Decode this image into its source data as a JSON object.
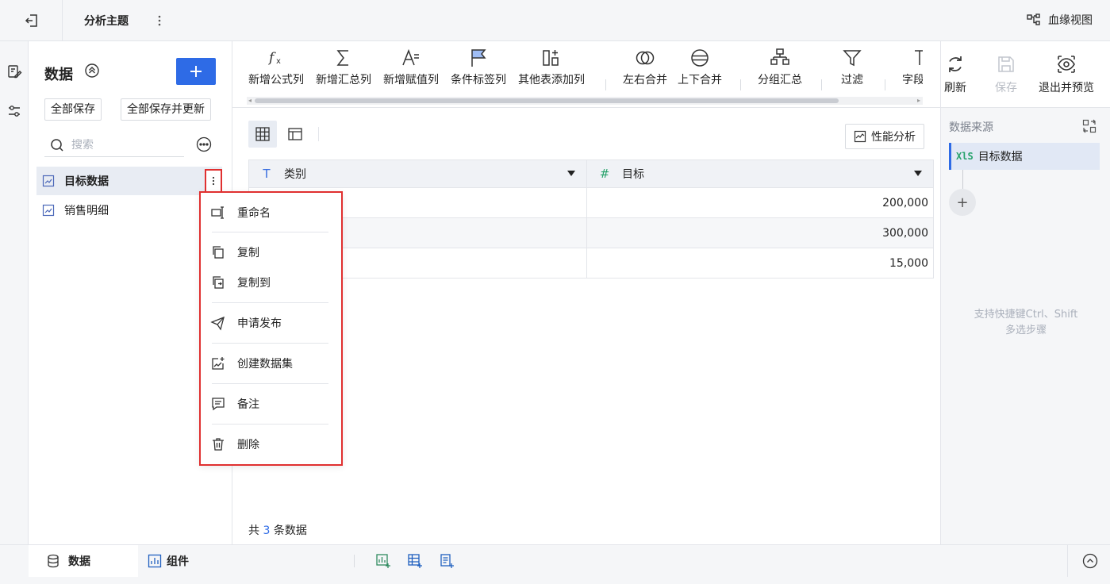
{
  "header": {
    "title": "分析主题",
    "lineage_label": "血缘视图"
  },
  "left_panel": {
    "title": "数据",
    "save_all": "全部保存",
    "save_all_update": "全部保存并更新",
    "search_placeholder": "搜索",
    "datasets": [
      {
        "name": "目标数据",
        "active": true
      },
      {
        "name": "销售明细",
        "active": false
      }
    ]
  },
  "context_menu": {
    "items": [
      {
        "label": "重命名",
        "icon": "rename-icon"
      },
      {
        "label": "复制",
        "icon": "copy-icon"
      },
      {
        "label": "复制到",
        "icon": "copy-to-icon"
      },
      {
        "label": "申请发布",
        "icon": "publish-icon"
      },
      {
        "label": "创建数据集",
        "icon": "create-dataset-icon"
      },
      {
        "label": "备注",
        "icon": "note-icon"
      },
      {
        "label": "删除",
        "icon": "trash-icon"
      }
    ]
  },
  "toolbar": {
    "items": [
      {
        "label": "新增公式列",
        "icon": "formula-icon"
      },
      {
        "label": "新增汇总列",
        "icon": "sum-icon"
      },
      {
        "label": "新增赋值列",
        "icon": "assign-icon"
      },
      {
        "label": "条件标签列",
        "icon": "flag-icon"
      },
      {
        "label": "其他表添加列",
        "icon": "add-column-icon"
      },
      {
        "label": "左右合并",
        "icon": "merge-horizontal-icon"
      },
      {
        "label": "上下合并",
        "icon": "merge-vertical-icon"
      },
      {
        "label": "分组汇总",
        "icon": "group-icon"
      },
      {
        "label": "过滤",
        "icon": "filter-icon"
      },
      {
        "label": "字段",
        "icon": "field-icon"
      }
    ],
    "refresh": "刷新",
    "save": "保存",
    "exit_preview": "退出并预览"
  },
  "main": {
    "perf_label": "性能分析",
    "columns": [
      {
        "name": "类别",
        "type": "text"
      },
      {
        "name": "目标",
        "type": "number"
      }
    ],
    "rows": [
      {
        "category": "",
        "target": "200,000"
      },
      {
        "category": "",
        "target": "300,000"
      },
      {
        "category": "",
        "target": "15,000"
      }
    ],
    "row_count_prefix": "共",
    "row_count": "3",
    "row_count_suffix": "条数据"
  },
  "right_panel": {
    "title": "数据来源",
    "source_badge": "XlS",
    "source_name": "目标数据",
    "add": "+",
    "hint_line1": "支持快捷键Ctrl、Shift",
    "hint_line2": "多选步骤"
  },
  "bottom": {
    "tab_data": "数据",
    "tab_component": "组件"
  },
  "colors": {
    "accent": "#2e6be6",
    "highlight_border": "#e03030",
    "number_type": "#27a26b"
  }
}
